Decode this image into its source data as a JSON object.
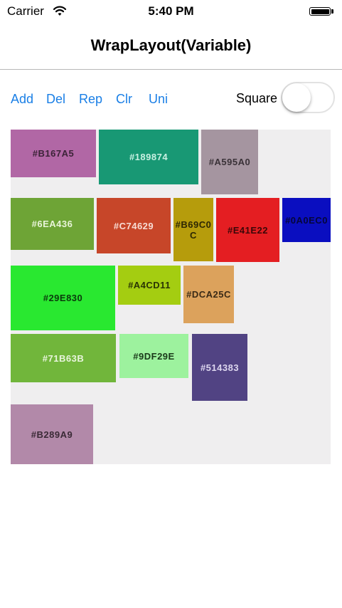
{
  "status": {
    "carrier": "Carrier",
    "time": "5:40 PM"
  },
  "nav": {
    "title": "WrapLayout(Variable)"
  },
  "toolbar": {
    "add_label": "Add",
    "del_label": "Del",
    "rep_label": "Rep",
    "clr_label": "Clr",
    "uni_label": "Uni",
    "square_label": "Square",
    "square_on": false
  },
  "tiles": [
    {
      "label": "#B167A5",
      "color": "#B167A5",
      "text_color": "#3c2338"
    },
    {
      "label": "#189874",
      "color": "#189874",
      "text_color": "#c8f0e2"
    },
    {
      "label": "#A595A0",
      "color": "#A595A0",
      "text_color": "#3a3238"
    },
    {
      "label": "#6EA436",
      "color": "#6EA436",
      "text_color": "#e8f4d8"
    },
    {
      "label": "#C74629",
      "color": "#C74629",
      "text_color": "#f8dcd4"
    },
    {
      "label": "#B69C0C",
      "color": "#B69C0C",
      "text_color": "#2d2703"
    },
    {
      "label": "#E41E22",
      "color": "#E41E22",
      "text_color": "#3a0708"
    },
    {
      "label": "#0A0EC0",
      "color": "#0A0EC0",
      "text_color": "#05063a"
    },
    {
      "label": "#29E830",
      "color": "#29E830",
      "text_color": "#0a3a0c"
    },
    {
      "label": "#A4CD11",
      "color": "#A4CD11",
      "text_color": "#2a3404"
    },
    {
      "label": "#DCA25C",
      "color": "#DCA25C",
      "text_color": "#3a2a16"
    },
    {
      "label": "#71B63B",
      "color": "#71B63B",
      "text_color": "#e8f4dc"
    },
    {
      "label": "#9DF29E",
      "color": "#9DF29E",
      "text_color": "#1a3a1a"
    },
    {
      "label": "#514383",
      "color": "#514383",
      "text_color": "#dcd6ee"
    },
    {
      "label": "#B289A9",
      "color": "#B289A9",
      "text_color": "#3a2a36"
    }
  ]
}
